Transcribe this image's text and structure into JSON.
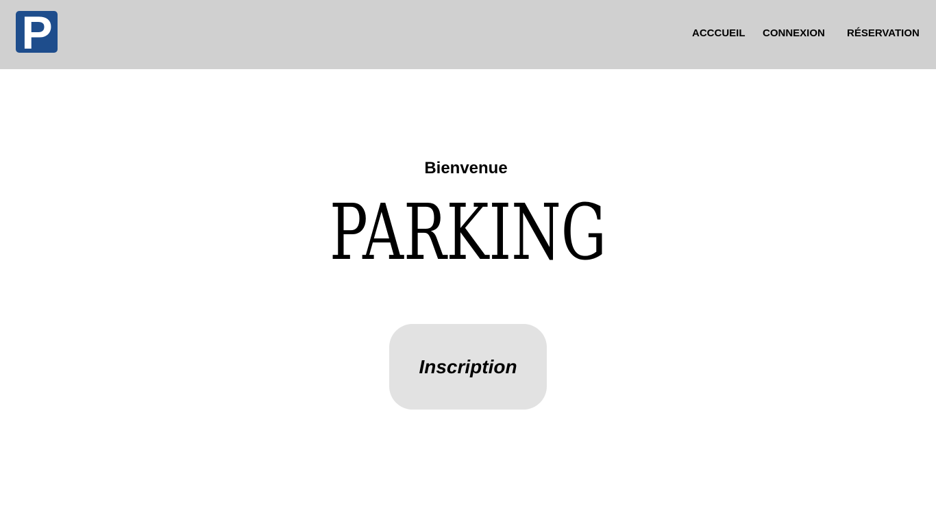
{
  "header": {
    "logo": {
      "icon": "parking-sign-icon",
      "letter": "P",
      "color": "#1e4d8c"
    },
    "nav": [
      {
        "label": "ACCCUEIL"
      },
      {
        "label": "CONNEXION"
      },
      {
        "label": "RÉSERVATION"
      }
    ],
    "background": "#d0d0d0"
  },
  "hero": {
    "welcome": "Bienvenue",
    "title": "PARKING",
    "cta_label": "Inscription",
    "cta_background": "#e2e2e2"
  }
}
